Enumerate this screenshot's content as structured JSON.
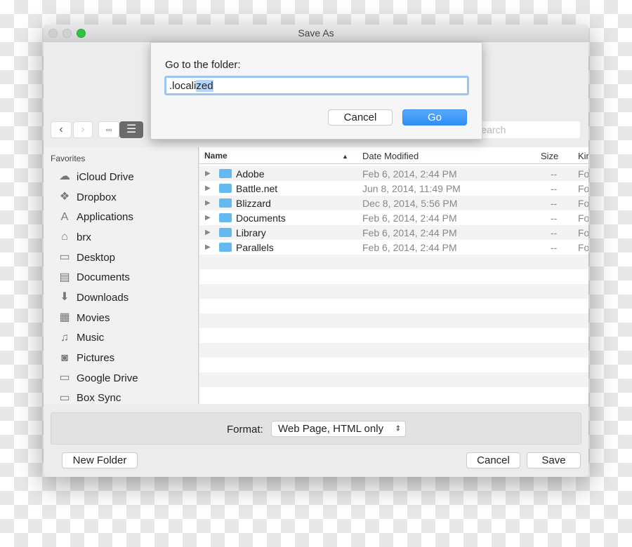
{
  "window": {
    "title": "Save As"
  },
  "toolbar": {
    "back": "‹",
    "forward": "›",
    "search_placeholder": "Search"
  },
  "sidebar": {
    "heading": "Favorites",
    "items": [
      {
        "label": "iCloud Drive",
        "icon": "☁"
      },
      {
        "label": "Dropbox",
        "icon": "❖"
      },
      {
        "label": "Applications",
        "icon": "A"
      },
      {
        "label": "brx",
        "icon": "⌂"
      },
      {
        "label": "Desktop",
        "icon": "▭"
      },
      {
        "label": "Documents",
        "icon": "▤"
      },
      {
        "label": "Downloads",
        "icon": "⬇"
      },
      {
        "label": "Movies",
        "icon": "▦"
      },
      {
        "label": "Music",
        "icon": "♫"
      },
      {
        "label": "Pictures",
        "icon": "◙"
      },
      {
        "label": "Google Drive",
        "icon": "▭"
      },
      {
        "label": "Box Sync",
        "icon": "▭"
      }
    ]
  },
  "list": {
    "columns": {
      "name": "Name",
      "date": "Date Modified",
      "size": "Size",
      "kind": "Kin"
    },
    "rows": [
      {
        "name": "Adobe",
        "date": "Feb 6, 2014, 2:44 PM",
        "size": "--",
        "kind": "Fo"
      },
      {
        "name": "Battle.net",
        "date": "Jun 8, 2014, 11:49 PM",
        "size": "--",
        "kind": "Fo"
      },
      {
        "name": "Blizzard",
        "date": "Dec 8, 2014, 5:56 PM",
        "size": "--",
        "kind": "Fo"
      },
      {
        "name": "Documents",
        "date": "Feb 6, 2014, 2:44 PM",
        "size": "--",
        "kind": "Fo"
      },
      {
        "name": "Library",
        "date": "Feb 6, 2014, 2:44 PM",
        "size": "--",
        "kind": "Fo"
      },
      {
        "name": "Parallels",
        "date": "Feb 6, 2014, 2:44 PM",
        "size": "--",
        "kind": "Fo"
      }
    ]
  },
  "format": {
    "label": "Format:",
    "value": "Web Page, HTML only"
  },
  "buttons": {
    "new_folder": "New Folder",
    "cancel": "Cancel",
    "save": "Save"
  },
  "dialog": {
    "prompt": "Go to the folder:",
    "value_plain": ".locali",
    "value_selected": "zed",
    "cancel": "Cancel",
    "go": "Go",
    "accent": "#2f8ff5"
  }
}
